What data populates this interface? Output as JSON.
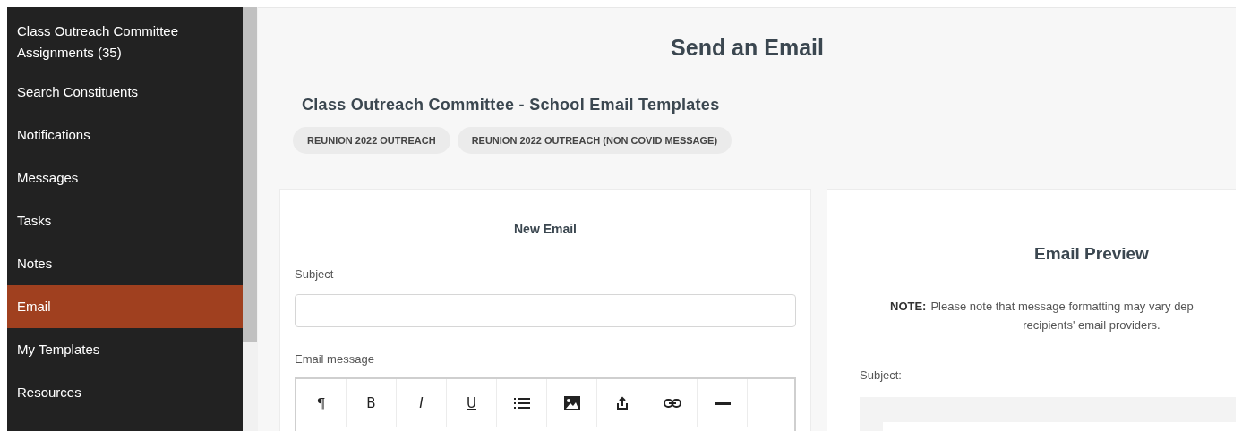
{
  "sidebar": {
    "items": [
      {
        "label": "Class Outreach Committee Assignments (35)",
        "selected": false
      },
      {
        "label": "Search Constituents",
        "selected": false
      },
      {
        "label": "Notifications",
        "selected": false
      },
      {
        "label": "Messages",
        "selected": false
      },
      {
        "label": "Tasks",
        "selected": false
      },
      {
        "label": "Notes",
        "selected": false
      },
      {
        "label": "Email",
        "selected": true
      },
      {
        "label": "My Templates",
        "selected": false
      },
      {
        "label": "Resources",
        "selected": false
      }
    ]
  },
  "page_title": "Send an Email",
  "templates": {
    "heading": "Class Outreach Committee - School Email Templates",
    "chips": [
      "REUNION 2022 OUTREACH",
      "REUNION 2022 OUTREACH (NON COVID MESSAGE)"
    ]
  },
  "new_email": {
    "title": "New Email",
    "subject_label": "Subject",
    "message_label": "Email message",
    "toolbar": [
      {
        "kind": "text",
        "label": "¶"
      },
      {
        "kind": "text",
        "label": "B"
      },
      {
        "kind": "text",
        "label": "I"
      },
      {
        "kind": "text",
        "label": "U"
      },
      {
        "kind": "list"
      },
      {
        "kind": "image"
      },
      {
        "kind": "upload"
      },
      {
        "kind": "link"
      },
      {
        "kind": "rule"
      }
    ]
  },
  "preview": {
    "title": "Email Preview",
    "note_label": "NOTE:",
    "note_lines": [
      "Please note that message formatting may vary dep",
      "recipients' email providers."
    ],
    "subject_label": "Subject:"
  }
}
